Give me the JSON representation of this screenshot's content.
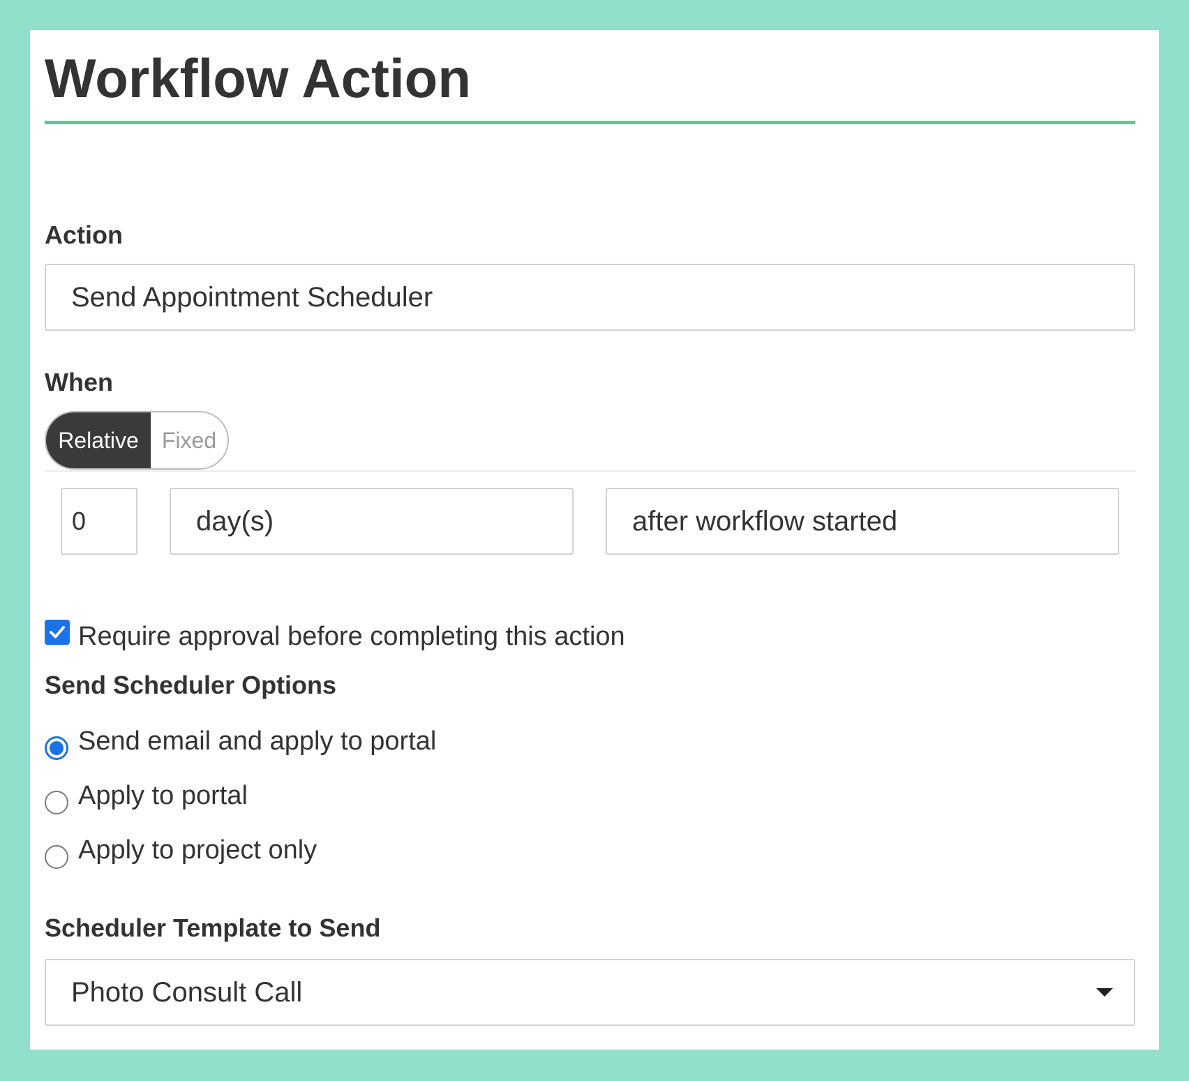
{
  "header": {
    "title": "Workflow Action"
  },
  "action": {
    "label": "Action",
    "value": "Send Appointment Scheduler"
  },
  "when": {
    "label": "When",
    "toggle": {
      "options": [
        "Relative",
        "Fixed"
      ],
      "selected": "Relative"
    },
    "amount": "0",
    "unit": "day(s)",
    "anchor": "after workflow started"
  },
  "approval": {
    "label": "Require approval before completing this action",
    "checked": true
  },
  "scheduler_options": {
    "label": "Send Scheduler Options",
    "options": [
      {
        "label": "Send email and apply to portal",
        "selected": true
      },
      {
        "label": "Apply to portal",
        "selected": false
      },
      {
        "label": "Apply to project only",
        "selected": false
      }
    ]
  },
  "template": {
    "label": "Scheduler Template to Send",
    "value": "Photo Consult Call"
  },
  "colors": {
    "background": "#90e0cc",
    "accent_rule": "#5fc79a",
    "toggle_active": "#3a3a3a",
    "control_blue": "#1a73e8"
  }
}
